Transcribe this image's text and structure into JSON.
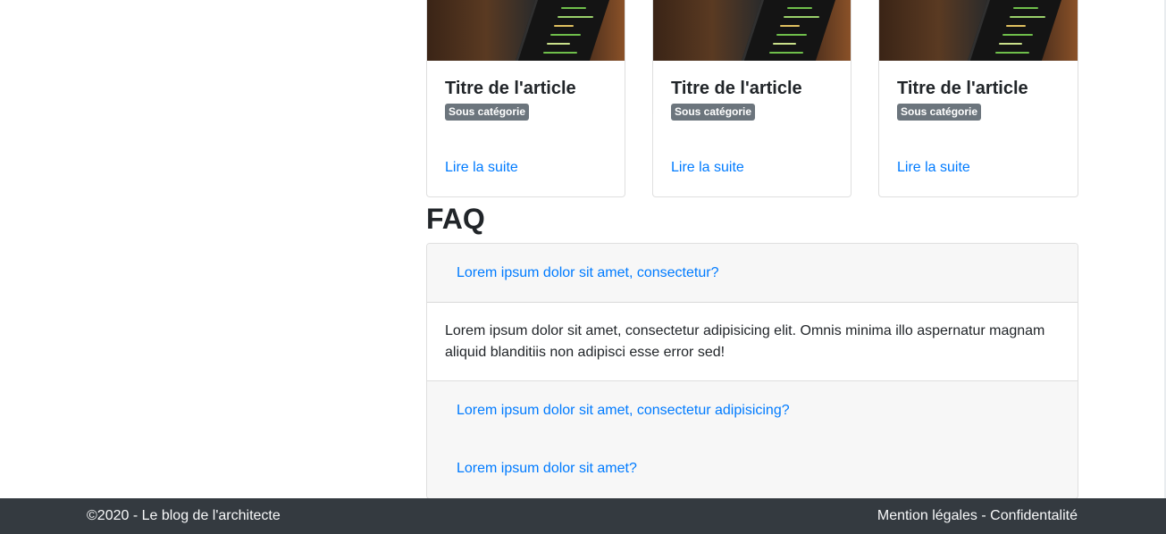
{
  "articles": [
    {
      "title": "Titre de l'article",
      "badge": "Sous catégorie",
      "link": "Lire la suite"
    },
    {
      "title": "Titre de l'article",
      "badge": "Sous catégorie",
      "link": "Lire la suite"
    },
    {
      "title": "Titre de l'article",
      "badge": "Sous catégorie",
      "link": "Lire la suite"
    }
  ],
  "faq": {
    "title": "FAQ",
    "items": [
      {
        "question": "Lorem ipsum dolor sit amet, consectetur?",
        "answer": "Lorem ipsum dolor sit amet, consectetur adipisicing elit. Omnis minima illo aspernatur magnam aliquid blanditiis non adipisci esse error sed!"
      },
      {
        "question": "Lorem ipsum dolor sit amet, consectetur adipisicing?"
      },
      {
        "question": "Lorem ipsum dolor sit amet?"
      }
    ]
  },
  "footer": {
    "copyright": "©2020 - Le blog de l'architecte",
    "legal": "Mention légales",
    "separator": " - ",
    "privacy": "Confidentalité"
  },
  "colors": {
    "link": "#007bff",
    "badge": "#6c757d",
    "footer_bg": "#343a40"
  }
}
